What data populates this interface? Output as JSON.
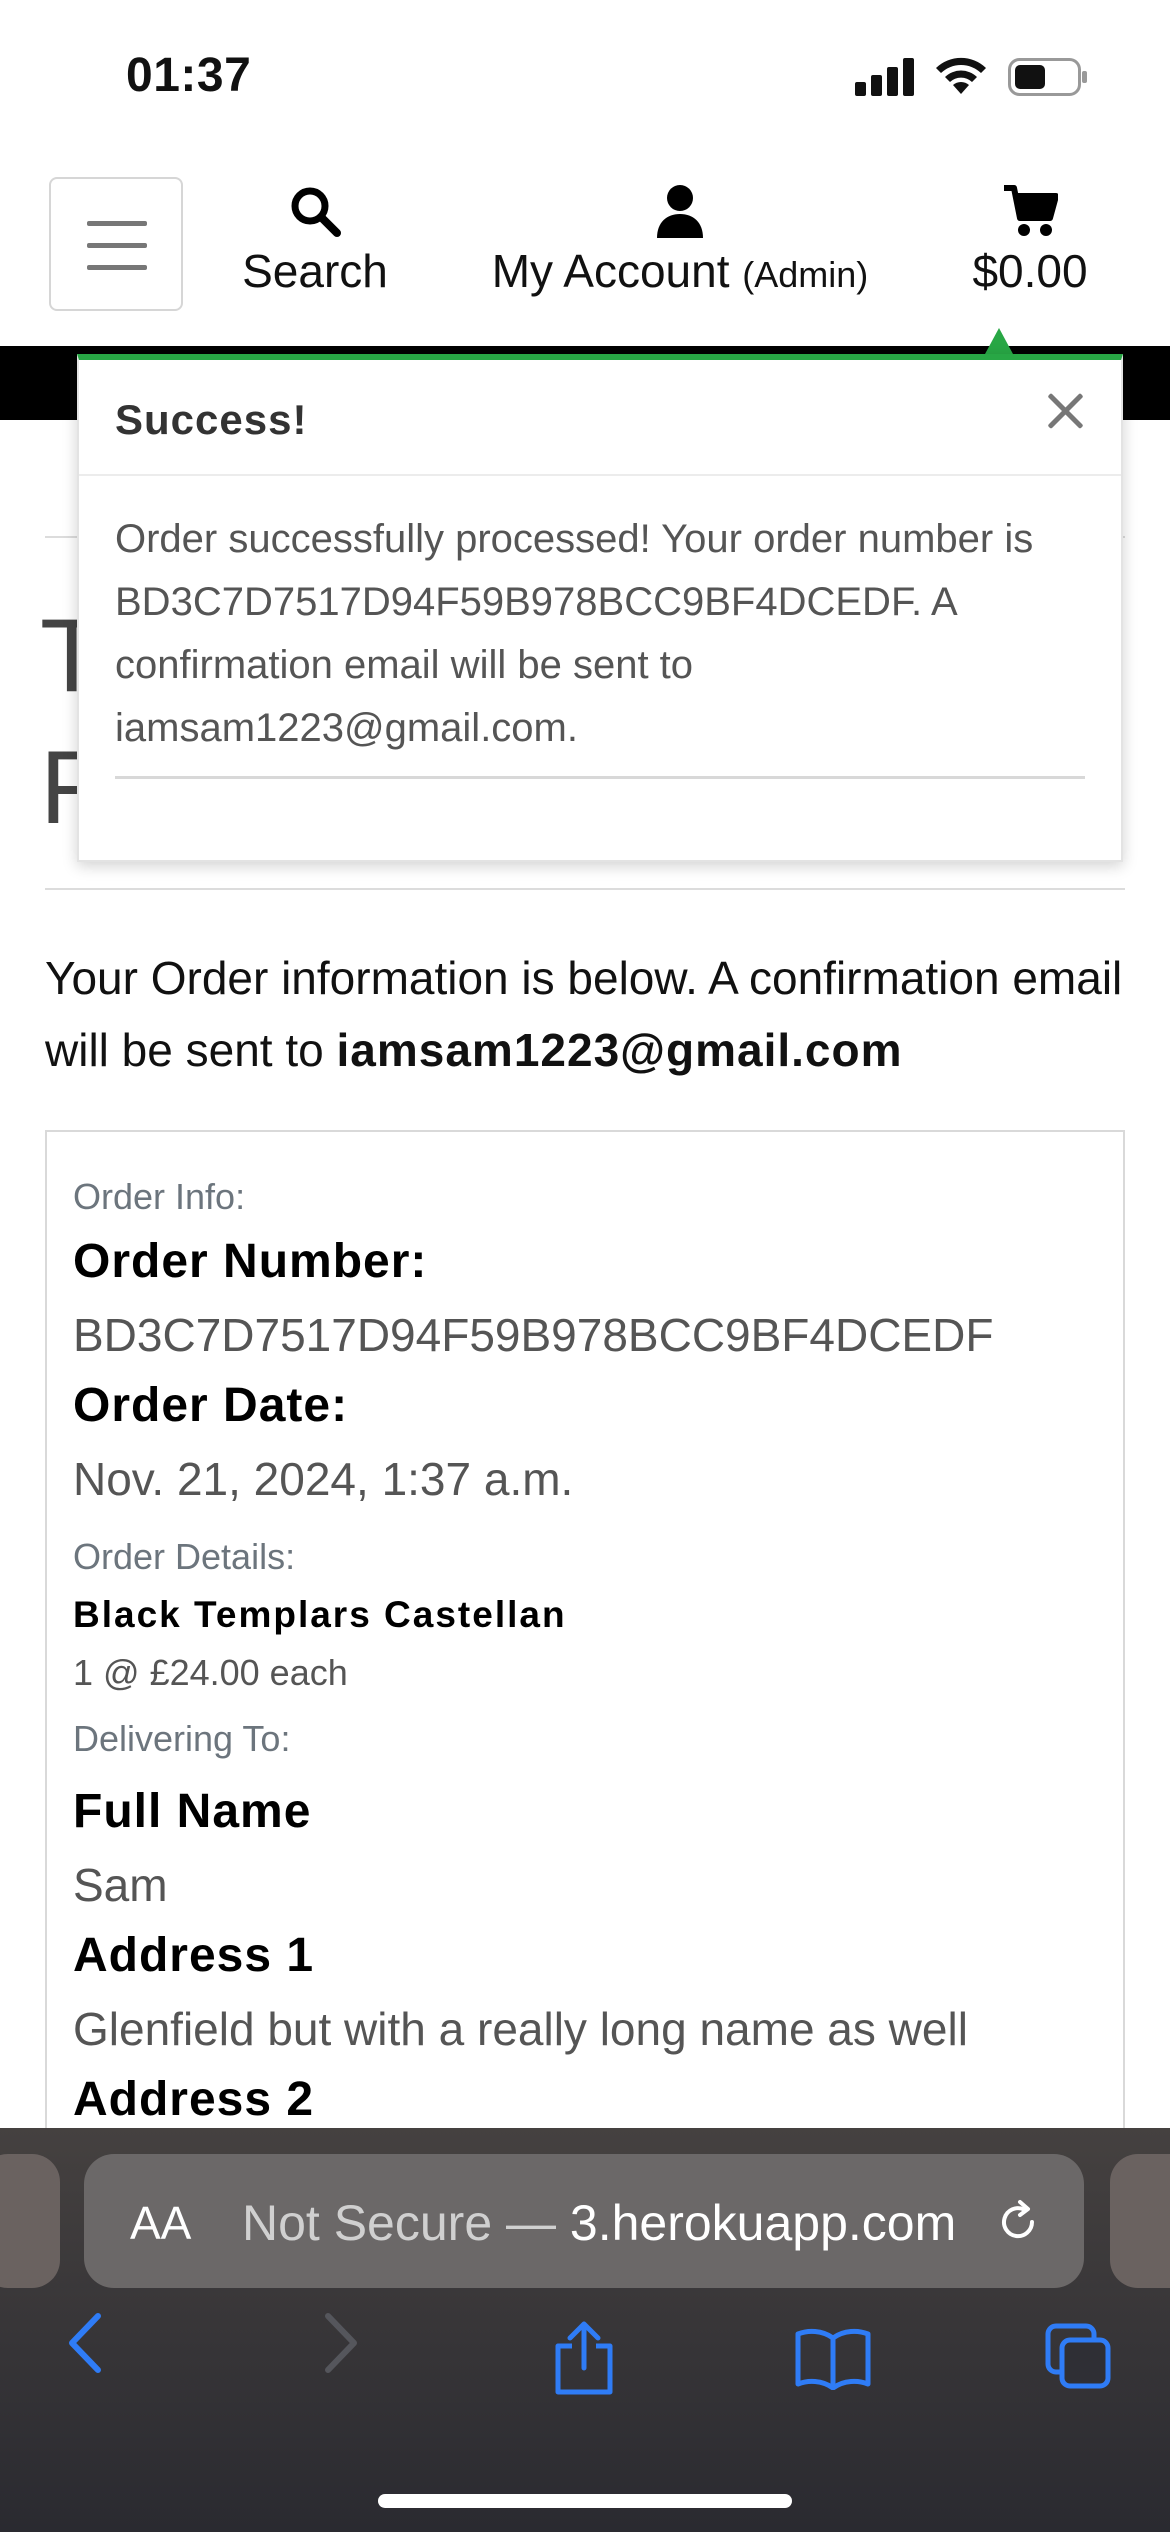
{
  "status_bar": {
    "time": "01:37"
  },
  "nav": {
    "search_label": "Search",
    "account_label": "My Account",
    "account_role": "(Admin)",
    "cart_total": "$0.00"
  },
  "toast": {
    "title": "Success!",
    "message": "Order successfully processed! Your order number is BD3C7D7517D94F59B978BCC9BF4DCEDF. A confirmation email will be sent to iamsam1223@gmail.com."
  },
  "page": {
    "partial_heading_letters": [
      "T",
      "F"
    ],
    "intro_text": "Your Order information is below. A confirmation email will be sent to",
    "intro_email": "iamsam1223@gmail.com"
  },
  "order": {
    "info_label": "Order Info:",
    "number_heading": "Order Number:",
    "number_value": "BD3C7D7517D94F59B978BCC9BF4DCEDF",
    "date_heading": "Order Date:",
    "date_value": "Nov. 21, 2024, 1:37 a.m.",
    "details_label": "Order Details:",
    "item_name": "Black Templars Castellan",
    "item_qty": "1 @ £24.00 each",
    "delivering_label": "Delivering To:",
    "full_name_heading": "Full Name",
    "full_name_value": "Sam",
    "address1_heading": "Address 1",
    "address1_value": "Glenfield but with a really long name as well",
    "address2_heading": "Address 2"
  },
  "browser": {
    "aa_label": "AA",
    "url_dim": "Not Secure — ",
    "url_main": "3.herokuapp.com"
  },
  "colors": {
    "success": "#28a745",
    "ios_blue": "#2f7cf6"
  }
}
